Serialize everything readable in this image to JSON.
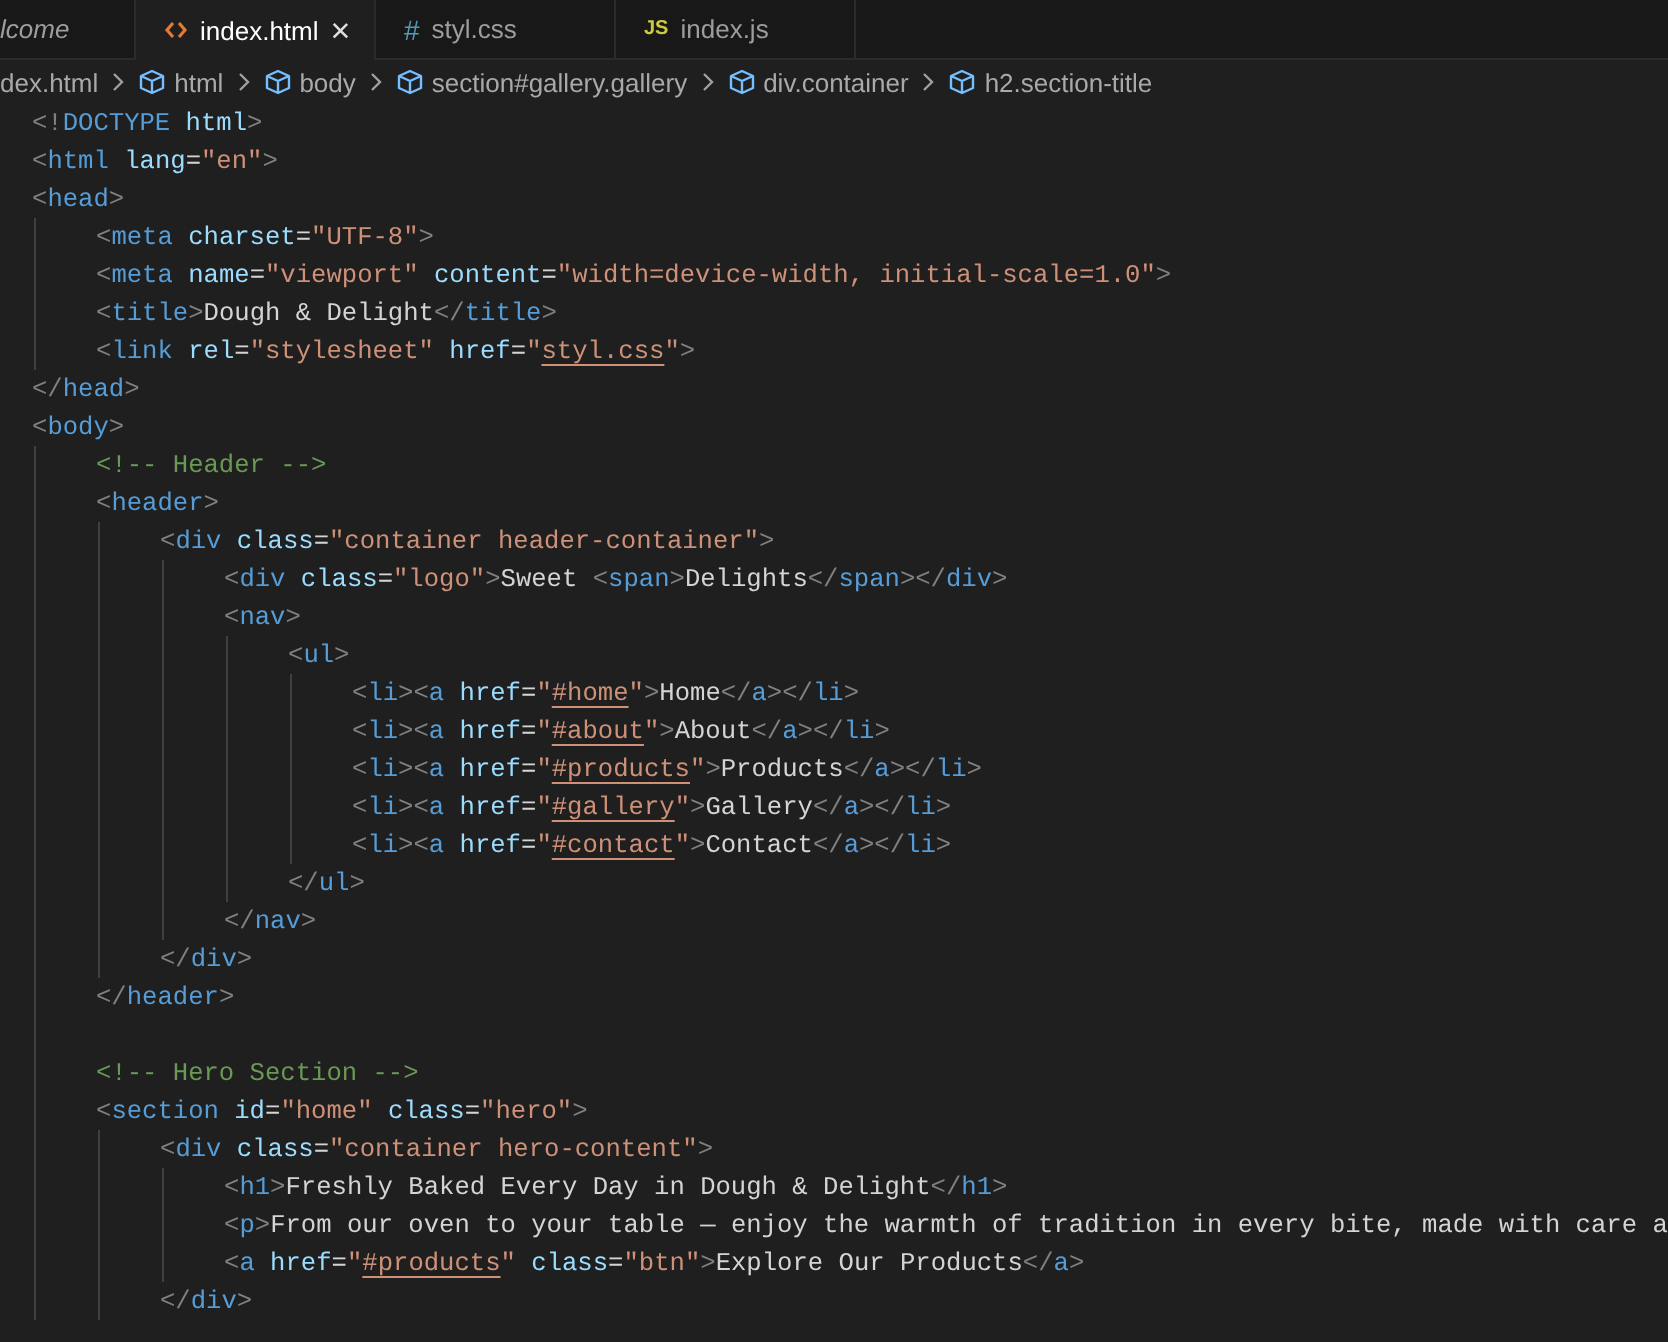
{
  "tabs": [
    {
      "label": "lcome",
      "kind": "preview",
      "selected": false
    },
    {
      "label": "index.html",
      "kind": "html",
      "selected": true,
      "close": "×"
    },
    {
      "label": "styl.css",
      "kind": "css",
      "icon": "#",
      "selected": false
    },
    {
      "label": "index.js",
      "kind": "js",
      "icon": "JS",
      "selected": false
    }
  ],
  "breadcrumb": [
    {
      "text": "dex.html",
      "kind": "file"
    },
    {
      "text": "html",
      "kind": "element"
    },
    {
      "text": "body",
      "kind": "element"
    },
    {
      "text": "section#gallery.gallery",
      "kind": "element"
    },
    {
      "text": "div.container",
      "kind": "element"
    },
    {
      "text": "h2.section-title",
      "kind": "element"
    }
  ],
  "code": [
    {
      "tokens": [
        {
          "kind": "punct",
          "text": "<!"
        },
        {
          "kind": "tag",
          "text": "DOCTYPE"
        },
        {
          "kind": "attr",
          "text": " html"
        },
        {
          "kind": "punct",
          "text": ">"
        }
      ]
    },
    {
      "tokens": [
        {
          "kind": "punct",
          "text": "<"
        },
        {
          "kind": "tag",
          "text": "html"
        },
        {
          "kind": "attr",
          "text": " lang"
        },
        {
          "kind": "op",
          "text": "="
        },
        {
          "kind": "string",
          "text": "\"en\""
        },
        {
          "kind": "punct",
          "text": ">"
        }
      ]
    },
    {
      "tokens": [
        {
          "kind": "punct",
          "text": "<"
        },
        {
          "kind": "tag",
          "text": "head"
        },
        {
          "kind": "punct",
          "text": ">"
        }
      ],
      "children": [
        {
          "tokens": [
            {
              "kind": "punct",
              "text": "<"
            },
            {
              "kind": "tag",
              "text": "meta"
            },
            {
              "kind": "attr",
              "text": " charset"
            },
            {
              "kind": "op",
              "text": "="
            },
            {
              "kind": "string",
              "text": "\"UTF-8\""
            },
            {
              "kind": "punct",
              "text": ">"
            }
          ]
        },
        {
          "tokens": [
            {
              "kind": "punct",
              "text": "<"
            },
            {
              "kind": "tag",
              "text": "meta"
            },
            {
              "kind": "attr",
              "text": " name"
            },
            {
              "kind": "op",
              "text": "="
            },
            {
              "kind": "string",
              "text": "\"viewport\""
            },
            {
              "kind": "attr",
              "text": " content"
            },
            {
              "kind": "op",
              "text": "="
            },
            {
              "kind": "string",
              "text": "\"width=device-width, initial-scale=1.0\""
            },
            {
              "kind": "punct",
              "text": ">"
            }
          ]
        },
        {
          "tokens": [
            {
              "kind": "punct",
              "text": "<"
            },
            {
              "kind": "tag",
              "text": "title"
            },
            {
              "kind": "punct",
              "text": ">"
            },
            {
              "kind": "text",
              "text": "Dough & Delight"
            },
            {
              "kind": "punct",
              "text": "</"
            },
            {
              "kind": "tag",
              "text": "title"
            },
            {
              "kind": "punct",
              "text": ">"
            }
          ]
        },
        {
          "tokens": [
            {
              "kind": "punct",
              "text": "<"
            },
            {
              "kind": "tag",
              "text": "link"
            },
            {
              "kind": "attr",
              "text": " rel"
            },
            {
              "kind": "op",
              "text": "="
            },
            {
              "kind": "string",
              "text": "\"stylesheet\""
            },
            {
              "kind": "attr",
              "text": " href"
            },
            {
              "kind": "op",
              "text": "="
            },
            {
              "kind": "string",
              "text": "\""
            },
            {
              "kind": "link",
              "text": "styl.css"
            },
            {
              "kind": "string",
              "text": "\""
            },
            {
              "kind": "punct",
              "text": ">"
            }
          ]
        }
      ]
    },
    {
      "tokens": [
        {
          "kind": "punct",
          "text": "</"
        },
        {
          "kind": "tag",
          "text": "head"
        },
        {
          "kind": "punct",
          "text": ">"
        }
      ]
    },
    {
      "tokens": [
        {
          "kind": "punct",
          "text": "<"
        },
        {
          "kind": "tag",
          "text": "body"
        },
        {
          "kind": "punct",
          "text": ">"
        }
      ],
      "children": [
        {
          "tokens": [
            {
              "kind": "comment",
              "text": "<!-- Header -->"
            }
          ]
        },
        {
          "tokens": [
            {
              "kind": "punct",
              "text": "<"
            },
            {
              "kind": "tag",
              "text": "header"
            },
            {
              "kind": "punct",
              "text": ">"
            }
          ],
          "children": [
            {
              "tokens": [
                {
                  "kind": "punct",
                  "text": "<"
                },
                {
                  "kind": "tag",
                  "text": "div"
                },
                {
                  "kind": "attr",
                  "text": " class"
                },
                {
                  "kind": "op",
                  "text": "="
                },
                {
                  "kind": "string",
                  "text": "\"container header-container\""
                },
                {
                  "kind": "punct",
                  "text": ">"
                }
              ],
              "children": [
                {
                  "tokens": [
                    {
                      "kind": "punct",
                      "text": "<"
                    },
                    {
                      "kind": "tag",
                      "text": "div"
                    },
                    {
                      "kind": "attr",
                      "text": " class"
                    },
                    {
                      "kind": "op",
                      "text": "="
                    },
                    {
                      "kind": "string",
                      "text": "\"logo\""
                    },
                    {
                      "kind": "punct",
                      "text": ">"
                    },
                    {
                      "kind": "text",
                      "text": "Sweet "
                    },
                    {
                      "kind": "punct",
                      "text": "<"
                    },
                    {
                      "kind": "tag",
                      "text": "span"
                    },
                    {
                      "kind": "punct",
                      "text": ">"
                    },
                    {
                      "kind": "text",
                      "text": "Delights"
                    },
                    {
                      "kind": "punct",
                      "text": "</"
                    },
                    {
                      "kind": "tag",
                      "text": "span"
                    },
                    {
                      "kind": "punct",
                      "text": "></"
                    },
                    {
                      "kind": "tag",
                      "text": "div"
                    },
                    {
                      "kind": "punct",
                      "text": ">"
                    }
                  ]
                },
                {
                  "tokens": [
                    {
                      "kind": "punct",
                      "text": "<"
                    },
                    {
                      "kind": "tag",
                      "text": "nav"
                    },
                    {
                      "kind": "punct",
                      "text": ">"
                    }
                  ],
                  "children": [
                    {
                      "tokens": [
                        {
                          "kind": "punct",
                          "text": "<"
                        },
                        {
                          "kind": "tag",
                          "text": "ul"
                        },
                        {
                          "kind": "punct",
                          "text": ">"
                        }
                      ],
                      "children": [
                        {
                          "tokens": [
                            {
                              "kind": "punct",
                              "text": "<"
                            },
                            {
                              "kind": "tag",
                              "text": "li"
                            },
                            {
                              "kind": "punct",
                              "text": "><"
                            },
                            {
                              "kind": "tag",
                              "text": "a"
                            },
                            {
                              "kind": "attr",
                              "text": " href"
                            },
                            {
                              "kind": "op",
                              "text": "="
                            },
                            {
                              "kind": "string",
                              "text": "\""
                            },
                            {
                              "kind": "link",
                              "text": "#home"
                            },
                            {
                              "kind": "string",
                              "text": "\""
                            },
                            {
                              "kind": "punct",
                              "text": ">"
                            },
                            {
                              "kind": "text",
                              "text": "Home"
                            },
                            {
                              "kind": "punct",
                              "text": "</"
                            },
                            {
                              "kind": "tag",
                              "text": "a"
                            },
                            {
                              "kind": "punct",
                              "text": "></"
                            },
                            {
                              "kind": "tag",
                              "text": "li"
                            },
                            {
                              "kind": "punct",
                              "text": ">"
                            }
                          ]
                        },
                        {
                          "tokens": [
                            {
                              "kind": "punct",
                              "text": "<"
                            },
                            {
                              "kind": "tag",
                              "text": "li"
                            },
                            {
                              "kind": "punct",
                              "text": "><"
                            },
                            {
                              "kind": "tag",
                              "text": "a"
                            },
                            {
                              "kind": "attr",
                              "text": " href"
                            },
                            {
                              "kind": "op",
                              "text": "="
                            },
                            {
                              "kind": "string",
                              "text": "\""
                            },
                            {
                              "kind": "link",
                              "text": "#about"
                            },
                            {
                              "kind": "string",
                              "text": "\""
                            },
                            {
                              "kind": "punct",
                              "text": ">"
                            },
                            {
                              "kind": "text",
                              "text": "About"
                            },
                            {
                              "kind": "punct",
                              "text": "</"
                            },
                            {
                              "kind": "tag",
                              "text": "a"
                            },
                            {
                              "kind": "punct",
                              "text": "></"
                            },
                            {
                              "kind": "tag",
                              "text": "li"
                            },
                            {
                              "kind": "punct",
                              "text": ">"
                            }
                          ]
                        },
                        {
                          "tokens": [
                            {
                              "kind": "punct",
                              "text": "<"
                            },
                            {
                              "kind": "tag",
                              "text": "li"
                            },
                            {
                              "kind": "punct",
                              "text": "><"
                            },
                            {
                              "kind": "tag",
                              "text": "a"
                            },
                            {
                              "kind": "attr",
                              "text": " href"
                            },
                            {
                              "kind": "op",
                              "text": "="
                            },
                            {
                              "kind": "string",
                              "text": "\""
                            },
                            {
                              "kind": "link",
                              "text": "#products"
                            },
                            {
                              "kind": "string",
                              "text": "\""
                            },
                            {
                              "kind": "punct",
                              "text": ">"
                            },
                            {
                              "kind": "text",
                              "text": "Products"
                            },
                            {
                              "kind": "punct",
                              "text": "</"
                            },
                            {
                              "kind": "tag",
                              "text": "a"
                            },
                            {
                              "kind": "punct",
                              "text": "></"
                            },
                            {
                              "kind": "tag",
                              "text": "li"
                            },
                            {
                              "kind": "punct",
                              "text": ">"
                            }
                          ]
                        },
                        {
                          "tokens": [
                            {
                              "kind": "punct",
                              "text": "<"
                            },
                            {
                              "kind": "tag",
                              "text": "li"
                            },
                            {
                              "kind": "punct",
                              "text": "><"
                            },
                            {
                              "kind": "tag",
                              "text": "a"
                            },
                            {
                              "kind": "attr",
                              "text": " href"
                            },
                            {
                              "kind": "op",
                              "text": "="
                            },
                            {
                              "kind": "string",
                              "text": "\""
                            },
                            {
                              "kind": "link",
                              "text": "#gallery"
                            },
                            {
                              "kind": "string",
                              "text": "\""
                            },
                            {
                              "kind": "punct",
                              "text": ">"
                            },
                            {
                              "kind": "text",
                              "text": "Gallery"
                            },
                            {
                              "kind": "punct",
                              "text": "</"
                            },
                            {
                              "kind": "tag",
                              "text": "a"
                            },
                            {
                              "kind": "punct",
                              "text": "></"
                            },
                            {
                              "kind": "tag",
                              "text": "li"
                            },
                            {
                              "kind": "punct",
                              "text": ">"
                            }
                          ]
                        },
                        {
                          "tokens": [
                            {
                              "kind": "punct",
                              "text": "<"
                            },
                            {
                              "kind": "tag",
                              "text": "li"
                            },
                            {
                              "kind": "punct",
                              "text": "><"
                            },
                            {
                              "kind": "tag",
                              "text": "a"
                            },
                            {
                              "kind": "attr",
                              "text": " href"
                            },
                            {
                              "kind": "op",
                              "text": "="
                            },
                            {
                              "kind": "string",
                              "text": "\""
                            },
                            {
                              "kind": "link",
                              "text": "#contact"
                            },
                            {
                              "kind": "string",
                              "text": "\""
                            },
                            {
                              "kind": "punct",
                              "text": ">"
                            },
                            {
                              "kind": "text",
                              "text": "Contact"
                            },
                            {
                              "kind": "punct",
                              "text": "</"
                            },
                            {
                              "kind": "tag",
                              "text": "a"
                            },
                            {
                              "kind": "punct",
                              "text": "></"
                            },
                            {
                              "kind": "tag",
                              "text": "li"
                            },
                            {
                              "kind": "punct",
                              "text": ">"
                            }
                          ]
                        }
                      ]
                    },
                    {
                      "tokens": [
                        {
                          "kind": "punct",
                          "text": "</"
                        },
                        {
                          "kind": "tag",
                          "text": "ul"
                        },
                        {
                          "kind": "punct",
                          "text": ">"
                        }
                      ]
                    }
                  ]
                },
                {
                  "tokens": [
                    {
                      "kind": "punct",
                      "text": "</"
                    },
                    {
                      "kind": "tag",
                      "text": "nav"
                    },
                    {
                      "kind": "punct",
                      "text": ">"
                    }
                  ]
                }
              ]
            },
            {
              "tokens": [
                {
                  "kind": "punct",
                  "text": "</"
                },
                {
                  "kind": "tag",
                  "text": "div"
                },
                {
                  "kind": "punct",
                  "text": ">"
                }
              ]
            }
          ]
        },
        {
          "tokens": [
            {
              "kind": "punct",
              "text": "</"
            },
            {
              "kind": "tag",
              "text": "header"
            },
            {
              "kind": "punct",
              "text": ">"
            }
          ]
        },
        {
          "kind": "blank"
        },
        {
          "tokens": [
            {
              "kind": "comment",
              "text": "<!-- Hero Section -->"
            }
          ]
        },
        {
          "tokens": [
            {
              "kind": "punct",
              "text": "<"
            },
            {
              "kind": "tag",
              "text": "section"
            },
            {
              "kind": "attr",
              "text": " id"
            },
            {
              "kind": "op",
              "text": "="
            },
            {
              "kind": "string",
              "text": "\"home\""
            },
            {
              "kind": "attr",
              "text": " class"
            },
            {
              "kind": "op",
              "text": "="
            },
            {
              "kind": "string",
              "text": "\"hero\""
            },
            {
              "kind": "punct",
              "text": ">"
            }
          ],
          "children": [
            {
              "tokens": [
                {
                  "kind": "punct",
                  "text": "<"
                },
                {
                  "kind": "tag",
                  "text": "div"
                },
                {
                  "kind": "attr",
                  "text": " class"
                },
                {
                  "kind": "op",
                  "text": "="
                },
                {
                  "kind": "string",
                  "text": "\"container hero-content\""
                },
                {
                  "kind": "punct",
                  "text": ">"
                }
              ],
              "children": [
                {
                  "tokens": [
                    {
                      "kind": "punct",
                      "text": "<"
                    },
                    {
                      "kind": "tag",
                      "text": "h1"
                    },
                    {
                      "kind": "punct",
                      "text": ">"
                    },
                    {
                      "kind": "text",
                      "text": "Freshly Baked Every Day in Dough & Delight"
                    },
                    {
                      "kind": "punct",
                      "text": "</"
                    },
                    {
                      "kind": "tag",
                      "text": "h1"
                    },
                    {
                      "kind": "punct",
                      "text": ">"
                    }
                  ]
                },
                {
                  "tokens": [
                    {
                      "kind": "punct",
                      "text": "<"
                    },
                    {
                      "kind": "tag",
                      "text": "p"
                    },
                    {
                      "kind": "punct",
                      "text": ">"
                    },
                    {
                      "kind": "text",
                      "text": "From our oven to your table — enjoy the warmth of tradition in every bite, made with care a"
                    }
                  ]
                },
                {
                  "tokens": [
                    {
                      "kind": "punct",
                      "text": "<"
                    },
                    {
                      "kind": "tag",
                      "text": "a"
                    },
                    {
                      "kind": "attr",
                      "text": " href"
                    },
                    {
                      "kind": "op",
                      "text": "="
                    },
                    {
                      "kind": "string",
                      "text": "\""
                    },
                    {
                      "kind": "link",
                      "text": "#products"
                    },
                    {
                      "kind": "string",
                      "text": "\""
                    },
                    {
                      "kind": "attr",
                      "text": " class"
                    },
                    {
                      "kind": "op",
                      "text": "="
                    },
                    {
                      "kind": "string",
                      "text": "\"btn\""
                    },
                    {
                      "kind": "punct",
                      "text": ">"
                    },
                    {
                      "kind": "text",
                      "text": "Explore Our Products"
                    },
                    {
                      "kind": "punct",
                      "text": "</"
                    },
                    {
                      "kind": "tag",
                      "text": "a"
                    },
                    {
                      "kind": "punct",
                      "text": ">"
                    }
                  ]
                }
              ]
            },
            {
              "tokens": [
                {
                  "kind": "punct",
                  "text": "</"
                },
                {
                  "kind": "tag",
                  "text": "div"
                },
                {
                  "kind": "punct",
                  "text": ">"
                }
              ]
            }
          ]
        }
      ]
    }
  ]
}
